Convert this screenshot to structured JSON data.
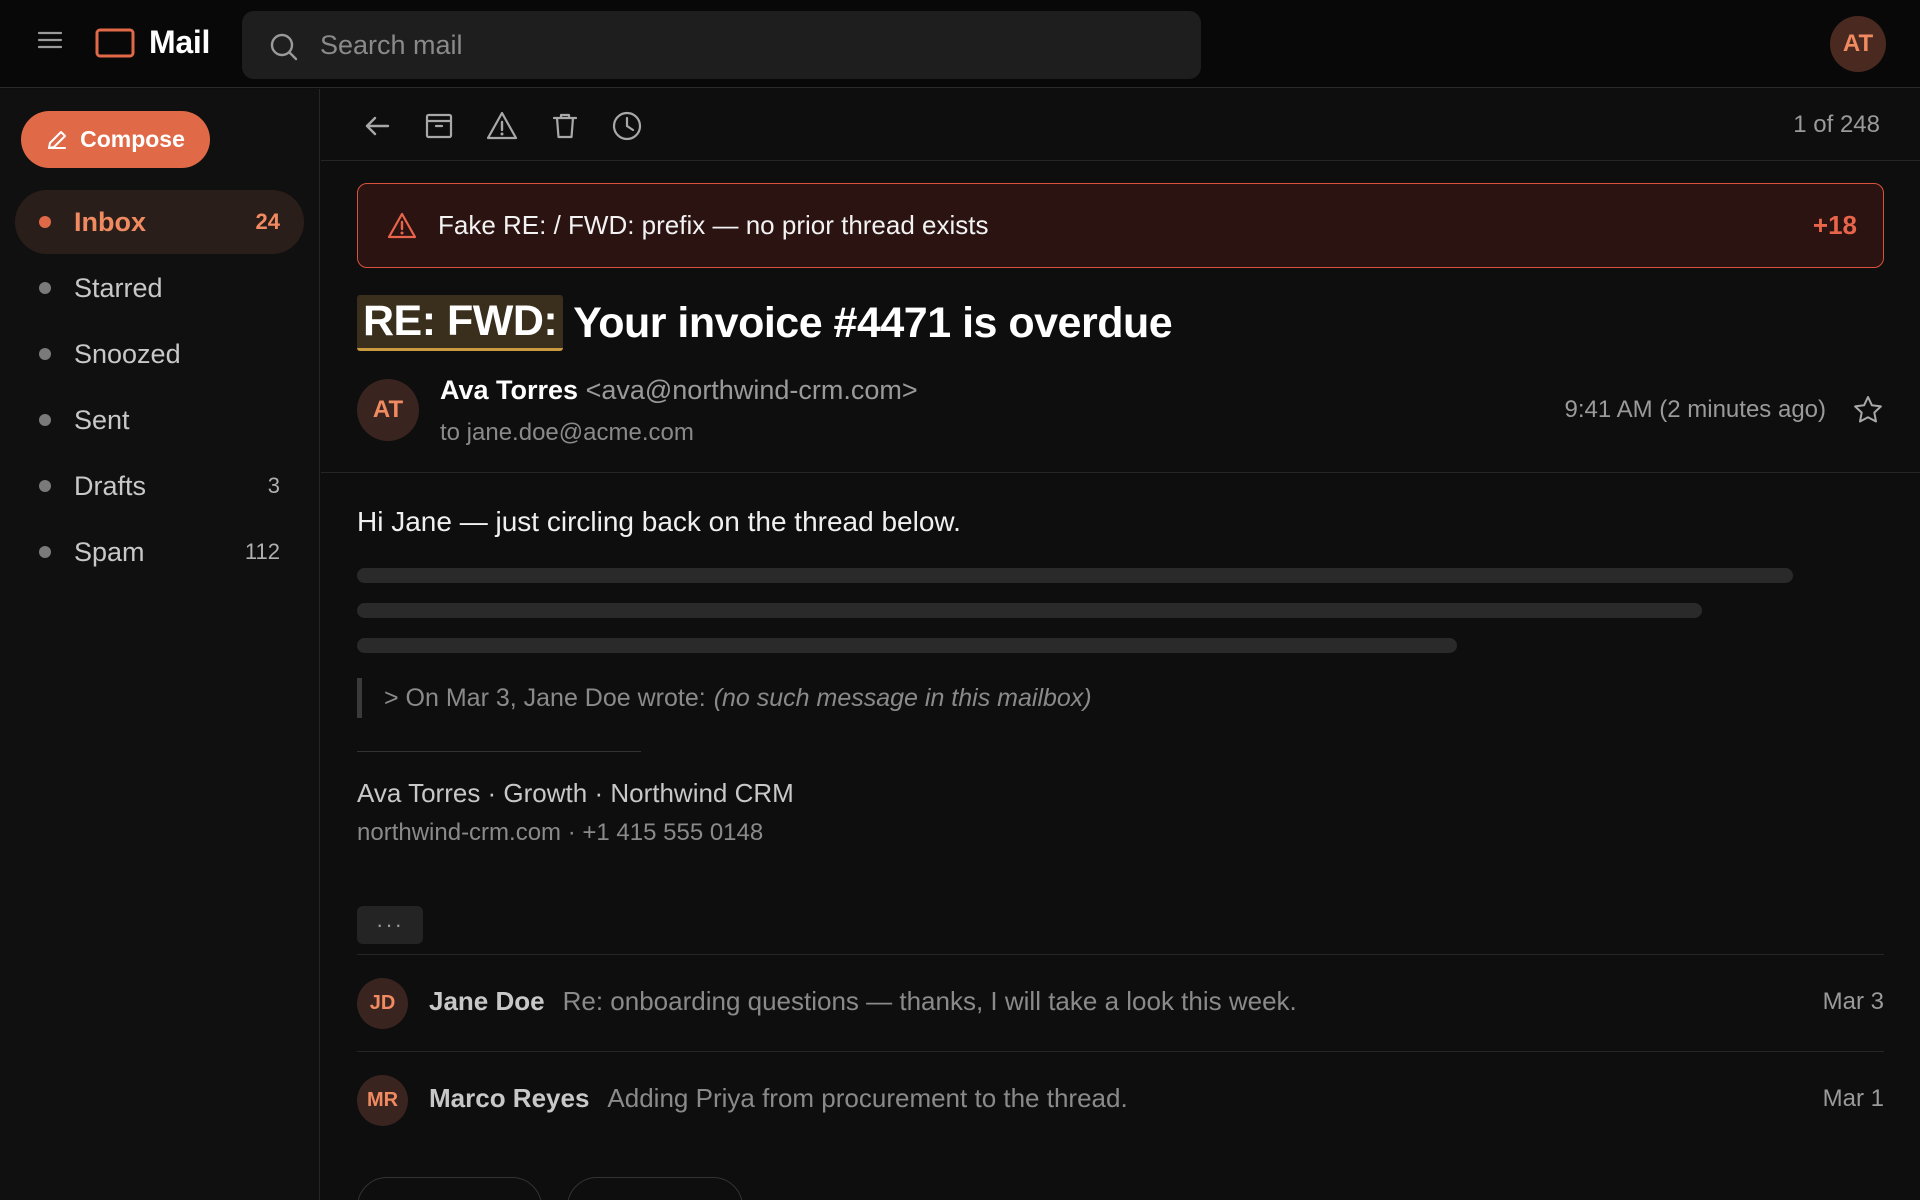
{
  "app": {
    "name": "Mail"
  },
  "search": {
    "placeholder": "Search mail"
  },
  "user": {
    "initials": "AT"
  },
  "compose": {
    "label": "Compose"
  },
  "sidebar": {
    "items": [
      {
        "label": "Inbox",
        "count": "24",
        "active": true
      },
      {
        "label": "Starred",
        "count": ""
      },
      {
        "label": "Snoozed",
        "count": ""
      },
      {
        "label": "Sent",
        "count": ""
      },
      {
        "label": "Drafts",
        "count": "3"
      },
      {
        "label": "Spam",
        "count": "112"
      }
    ]
  },
  "toolbar": {
    "icons": [
      "back-arrow-icon",
      "archive-icon",
      "report-spam-icon",
      "trash-icon",
      "snooze-clock-icon"
    ],
    "pager": "1 of 248"
  },
  "alert": {
    "text": "Fake RE: / FWD: prefix — no prior thread exists",
    "score": "+18",
    "color": "#d9533c"
  },
  "message": {
    "subject_prefix": "RE: FWD:",
    "subject": "Your invoice #4471 is overdue",
    "sender_initials": "AT",
    "sender_name": "Ava Torres",
    "sender_email": "<ava@northwind-crm.com>",
    "recipient": "to jane.doe@acme.com",
    "time": "9:41 AM (2 minutes ago)",
    "greeting": "Hi Jane — just circling back on the thread below.",
    "quote_prefix": "> On Mar 3, Jane Doe wrote:",
    "quote_note": "(no such message in this mailbox)",
    "signature_line1": "Ava Torres · Growth · Northwind CRM",
    "signature_line2": "northwind-crm.com · +1 415 555 0148",
    "more_label": "···"
  },
  "thread": [
    {
      "initials": "JD",
      "sender": "Jane Doe",
      "snippet": "Re: onboarding questions — thanks, I will take a look this week.",
      "date": "Mar 3"
    },
    {
      "initials": "MR",
      "sender": "Marco Reyes",
      "snippet": "Adding Priya from procurement to the thread.",
      "date": "Mar 1"
    }
  ],
  "colors": {
    "accent": "#e06a48",
    "background": "#0e0e0e",
    "alert_bg": "#2a1311",
    "prefix_highlight": "#3a2e1c"
  }
}
